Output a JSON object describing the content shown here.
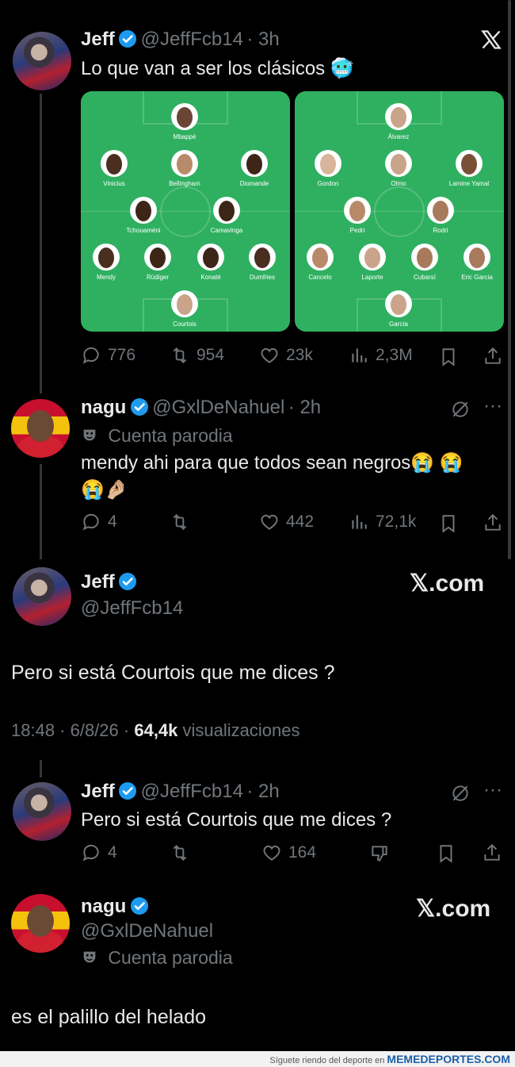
{
  "tweet1": {
    "name": "Jeff",
    "handle": "@JeffFcb14",
    "time": "· 3h",
    "text": "Lo que van a ser los clásicos 🥶",
    "lineup_left": [
      "Mbappé",
      "Vinicius",
      "Bellingham",
      "Diomande",
      "Tchouaméni",
      "Camavinga",
      "Mendy",
      "Rüdiger",
      "Konaté",
      "Dumfries",
      "Courtois"
    ],
    "lineup_right": [
      "Álvarez",
      "Gordon",
      "Olmo",
      "Lamine Yamal",
      "Pedri",
      "Rodri",
      "Cancelo",
      "Laporte",
      "Cubarsí",
      "Eric Garcia",
      "García"
    ],
    "stats": {
      "replies": "776",
      "retweets": "954",
      "likes": "23k",
      "views": "2,3M"
    }
  },
  "tweet2": {
    "name": "nagu",
    "handle": "@GxlDeNahuel",
    "time": "· 2h",
    "badge": "Cuenta parodia",
    "text_line1": "mendy ahi para que todos sean negros😭 😭",
    "text_line2": "😭🤌🏼",
    "stats": {
      "replies": "4",
      "likes": "442",
      "views": "72,1k"
    }
  },
  "reply_card1": {
    "name": "Jeff",
    "handle": "@JeffFcb14",
    "brand": "𝕏.com",
    "text": "Pero si está Courtois que me dices ?",
    "time": "18:48 · 6/8/26 ·",
    "views_count": "64,4k",
    "views_label": "visualizaciones"
  },
  "tweet3": {
    "name": "Jeff",
    "handle": "@JeffFcb14",
    "time": "· 2h",
    "text": "Pero si está Courtois que me dices ?",
    "stats": {
      "replies": "4",
      "likes": "164"
    }
  },
  "reply_card2": {
    "name": "nagu",
    "handle": "@GxlDeNahuel",
    "badge": "Cuenta parodia",
    "brand": "𝕏.com",
    "text": "es el palillo del helado"
  },
  "footer": {
    "prefix": "Síguete riendo del deporte en",
    "site": "MEMEDEPORTES.COM"
  },
  "colors": {
    "background": "#000000",
    "verified": "#1d9bf0",
    "muted": "#71767b",
    "pitch": "#2fb060"
  }
}
